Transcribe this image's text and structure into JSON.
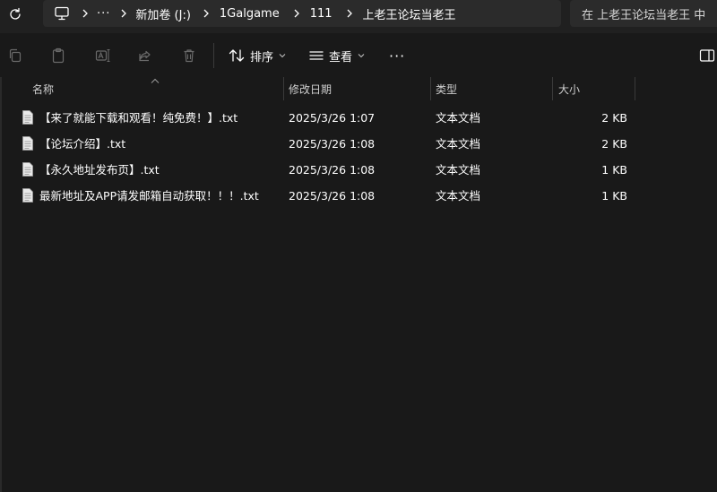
{
  "address_bar": {
    "overflow_label": "···",
    "crumbs": [
      "新加卷 (J:)",
      "1Galgame",
      "111",
      "上老王论坛当老王"
    ]
  },
  "search": {
    "placeholder": "在 上老王论坛当老王 中"
  },
  "toolbar": {
    "sort_label": "排序",
    "view_label": "查看",
    "more_label": "···"
  },
  "columns": {
    "name": "名称",
    "modified": "修改日期",
    "type": "类型",
    "size": "大小"
  },
  "files": [
    {
      "name": "【来了就能下载和观看！纯免费！】.txt",
      "modified": "2025/3/26 1:07",
      "type": "文本文档",
      "size": "2 KB"
    },
    {
      "name": "【论坛介绍】.txt",
      "modified": "2025/3/26 1:08",
      "type": "文本文档",
      "size": "2 KB"
    },
    {
      "name": "【永久地址发布页】.txt",
      "modified": "2025/3/26 1:08",
      "type": "文本文档",
      "size": "1 KB"
    },
    {
      "name": "最新地址及APP请发邮箱自动获取！！！.txt",
      "modified": "2025/3/26 1:08",
      "type": "文本文档",
      "size": "1 KB"
    }
  ],
  "icons": {
    "refresh": "refresh-icon",
    "computer": "computer-icon",
    "copy": "copy-icon",
    "paste": "paste-icon",
    "rename": "rename-icon",
    "share": "share-icon",
    "delete": "delete-icon",
    "sort": "sort-icon",
    "view": "view-icon",
    "details_pane": "details-pane-icon",
    "file": "text-file-icon"
  }
}
